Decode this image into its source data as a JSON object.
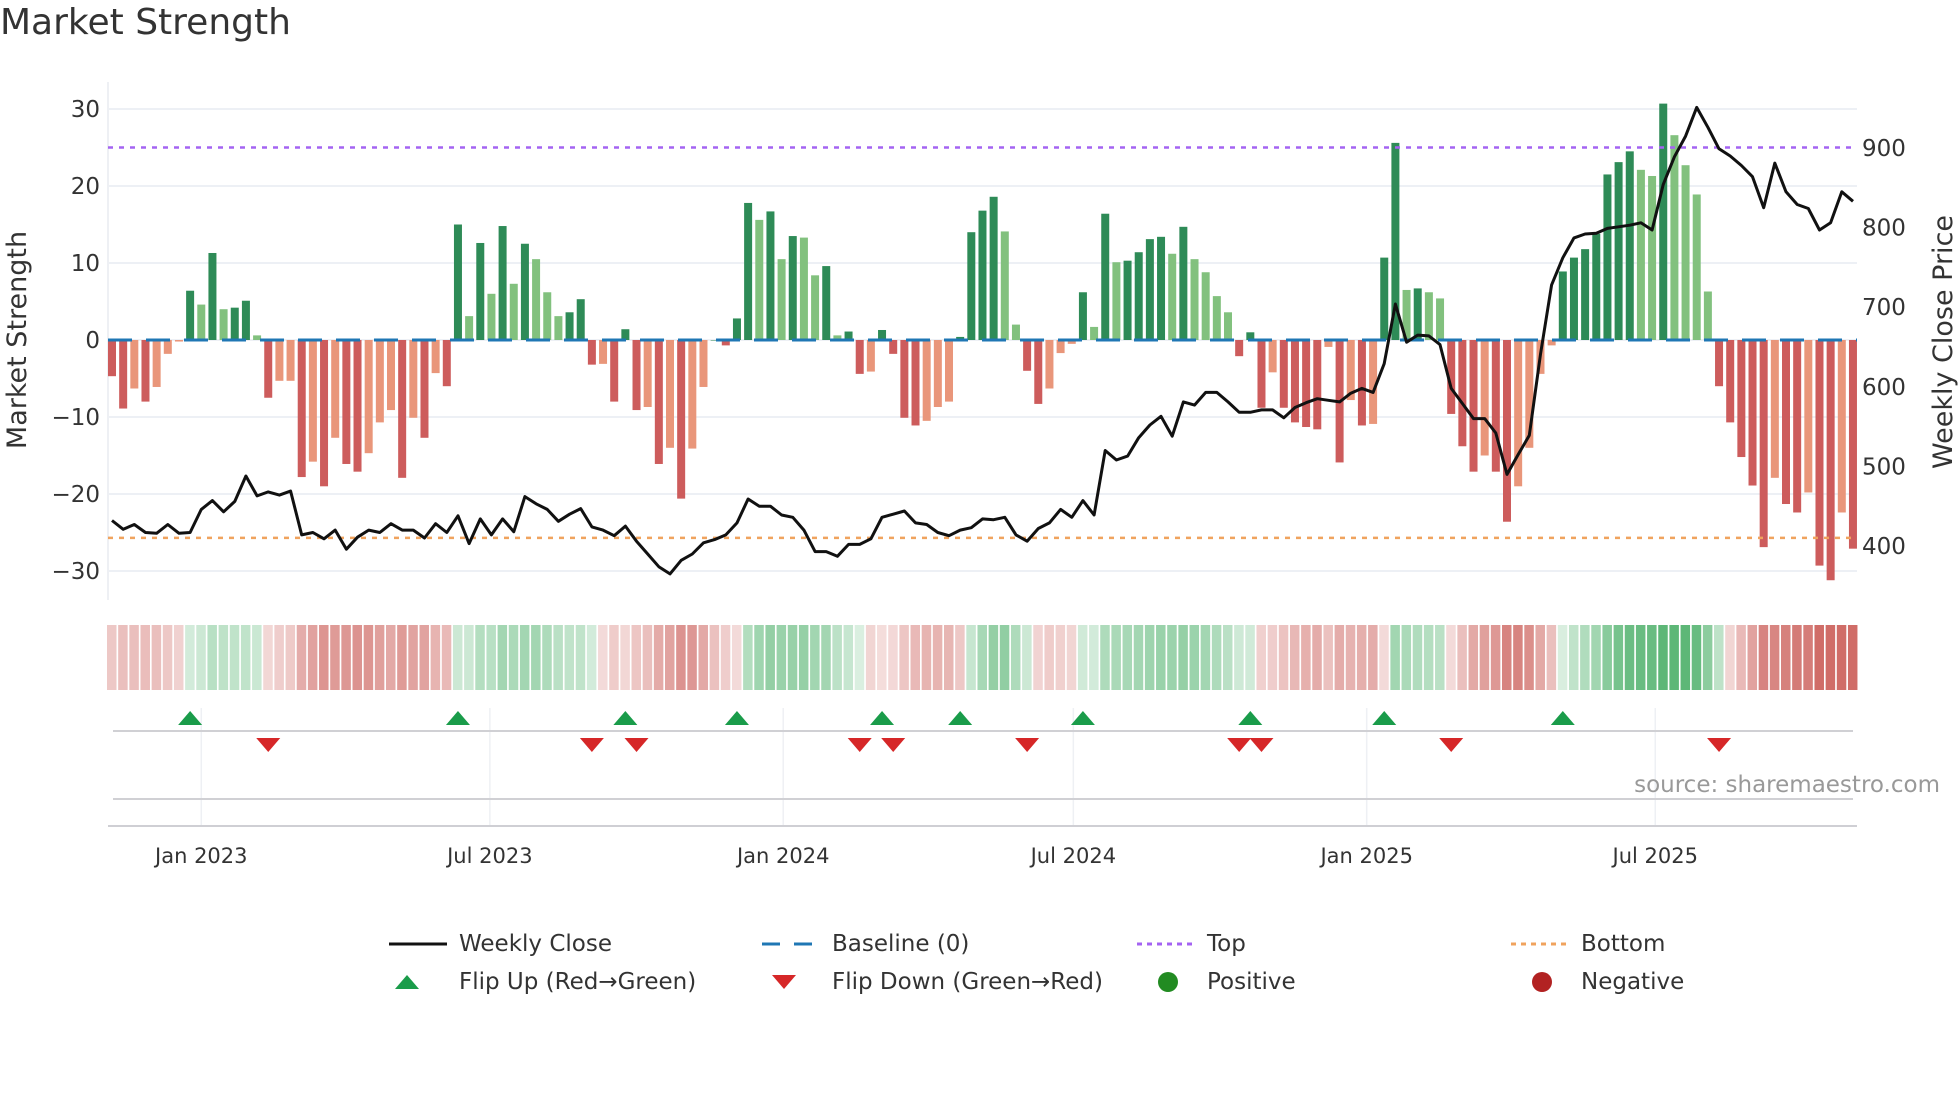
{
  "chart_data": {
    "type": "bar",
    "title": "Market Strength",
    "ylabel": "Market Strength",
    "y2label": "Weekly Close Price",
    "ylim": [
      -33,
      33
    ],
    "y2lim": [
      340,
      985
    ],
    "yticks": [
      "30",
      "20",
      "10",
      "0",
      "−10",
      "−20",
      "−30"
    ],
    "ytick_values": [
      30,
      20,
      10,
      0,
      -10,
      -20,
      -30
    ],
    "y2ticks": [
      "900",
      "800",
      "700",
      "600",
      "500",
      "400"
    ],
    "y2tick_values": [
      900,
      800,
      700,
      600,
      500,
      400
    ],
    "x_start": "2022-11-06",
    "x_step_days": 7,
    "xticks": [
      {
        "label": "Jan 2023",
        "date": "2023-01-01"
      },
      {
        "label": "Jul 2023",
        "date": "2023-07-01"
      },
      {
        "label": "Jan 2024",
        "date": "2024-01-01"
      },
      {
        "label": "Jul 2024",
        "date": "2024-07-01"
      },
      {
        "label": "Jan 2025",
        "date": "2025-01-01"
      },
      {
        "label": "Jul 2025",
        "date": "2025-07-01"
      }
    ],
    "grid": true,
    "top_level": 25,
    "bottom_level": -25.7,
    "baseline": 0,
    "strength": [
      -4.7,
      -8.9,
      -6.3,
      -8.0,
      -6.1,
      -1.8,
      -0.2,
      6.4,
      4.6,
      11.3,
      4.0,
      4.2,
      5.1,
      0.6,
      -7.5,
      -5.3,
      -5.3,
      -17.8,
      -15.8,
      -19.0,
      -12.7,
      -16.1,
      -17.1,
      -14.7,
      -10.7,
      -9.1,
      -17.9,
      -10.1,
      -12.7,
      -4.3,
      -6.0,
      15.0,
      3.1,
      12.6,
      6.0,
      14.8,
      7.3,
      12.5,
      10.5,
      6.2,
      3.1,
      3.6,
      5.3,
      -3.2,
      -3.1,
      -8.0,
      1.4,
      -9.1,
      -8.7,
      -16.1,
      -14.0,
      -20.6,
      -14.1,
      -6.1,
      0.0,
      -0.7,
      2.8,
      17.8,
      15.6,
      16.7,
      10.5,
      13.5,
      13.3,
      8.4,
      9.6,
      0.6,
      1.1,
      -4.4,
      -4.1,
      1.3,
      -1.8,
      -10.1,
      -11.1,
      -10.5,
      -8.7,
      -8.0,
      0.4,
      14.0,
      16.8,
      18.6,
      14.1,
      2.0,
      -4.0,
      -8.3,
      -6.3,
      -1.7,
      -0.5,
      6.2,
      1.7,
      16.4,
      10.1,
      10.3,
      11.4,
      13.1,
      13.4,
      11.2,
      14.7,
      10.5,
      8.8,
      5.7,
      3.6,
      -2.1,
      1.0,
      -8.8,
      -4.2,
      -8.8,
      -10.7,
      -11.3,
      -11.6,
      -0.9,
      -15.9,
      -7.8,
      -11.1,
      -10.9,
      10.7,
      25.6,
      6.5,
      6.7,
      6.2,
      5.4,
      -9.6,
      -13.8,
      -17.1,
      -15.0,
      -17.1,
      -23.6,
      -19.0,
      -14.0,
      -4.4,
      -0.7,
      8.9,
      10.7,
      11.8,
      13.8,
      21.5,
      23.1,
      24.5,
      22.1,
      21.3,
      30.7,
      26.6,
      22.7,
      18.9,
      6.3,
      -6.0,
      -10.7,
      -15.2,
      -18.9,
      -26.9,
      -17.9,
      -21.3,
      -22.4,
      -19.8,
      -29.3,
      -31.2,
      -22.4,
      -27.1
    ],
    "weekly_close": [
      432,
      421,
      427,
      417,
      416,
      427,
      416,
      417,
      446,
      457,
      443,
      456,
      488,
      463,
      468,
      464,
      469,
      414,
      417,
      409,
      420,
      396,
      411,
      420,
      417,
      428,
      420,
      420,
      410,
      428,
      417,
      438,
      403,
      434,
      414,
      434,
      418,
      462,
      453,
      446,
      431,
      440,
      447,
      424,
      420,
      413,
      425,
      406,
      390,
      374,
      365,
      382,
      390,
      404,
      408,
      414,
      429,
      459,
      450,
      450,
      439,
      436,
      420,
      393,
      393,
      387,
      402,
      402,
      409,
      436,
      440,
      444,
      429,
      427,
      417,
      413,
      420,
      423,
      434,
      433,
      436,
      414,
      406,
      422,
      429,
      446,
      436,
      457,
      439,
      520,
      508,
      513,
      536,
      552,
      563,
      538,
      581,
      577,
      593,
      593,
      581,
      568,
      568,
      571,
      571,
      561,
      574,
      580,
      585,
      583,
      581,
      592,
      598,
      593,
      629,
      704,
      656,
      665,
      664,
      653,
      598,
      579,
      560,
      560,
      542,
      490,
      515,
      539,
      641,
      728,
      762,
      787,
      792,
      793,
      799,
      801,
      803,
      806,
      797,
      854,
      889,
      915,
      951,
      926,
      899,
      890,
      878,
      864,
      825,
      881,
      845,
      829,
      824,
      797,
      806,
      845,
      833
    ],
    "flip_up_weeks": [
      8,
      32,
      47,
      57,
      70,
      77,
      88,
      103,
      115,
      131
    ],
    "flip_down_weeks": [
      15,
      44,
      48,
      68,
      71,
      83,
      102,
      104,
      121,
      145
    ],
    "colors": {
      "pos_strong": "#2e8b57",
      "pos_weak": "#82c17e",
      "neg_strong": "#cd5c5c",
      "neg_weak": "#e9967a",
      "close": "#111111",
      "baseline": "#1f77b4",
      "top": "#a463f2",
      "bottom": "#f0a35e",
      "flip_up": "#1a9c4a",
      "flip_down": "#d62728",
      "positive": "#228b22",
      "negative": "#b22222"
    },
    "legend": {
      "placement": "bottom",
      "entries": [
        "Weekly Close",
        "Baseline (0)",
        "Top",
        "Bottom",
        "Flip Up (Red→Green)",
        "Flip Down (Green→Red)",
        "Positive",
        "Negative"
      ]
    },
    "annotation": "source: sharemaestro.com"
  }
}
